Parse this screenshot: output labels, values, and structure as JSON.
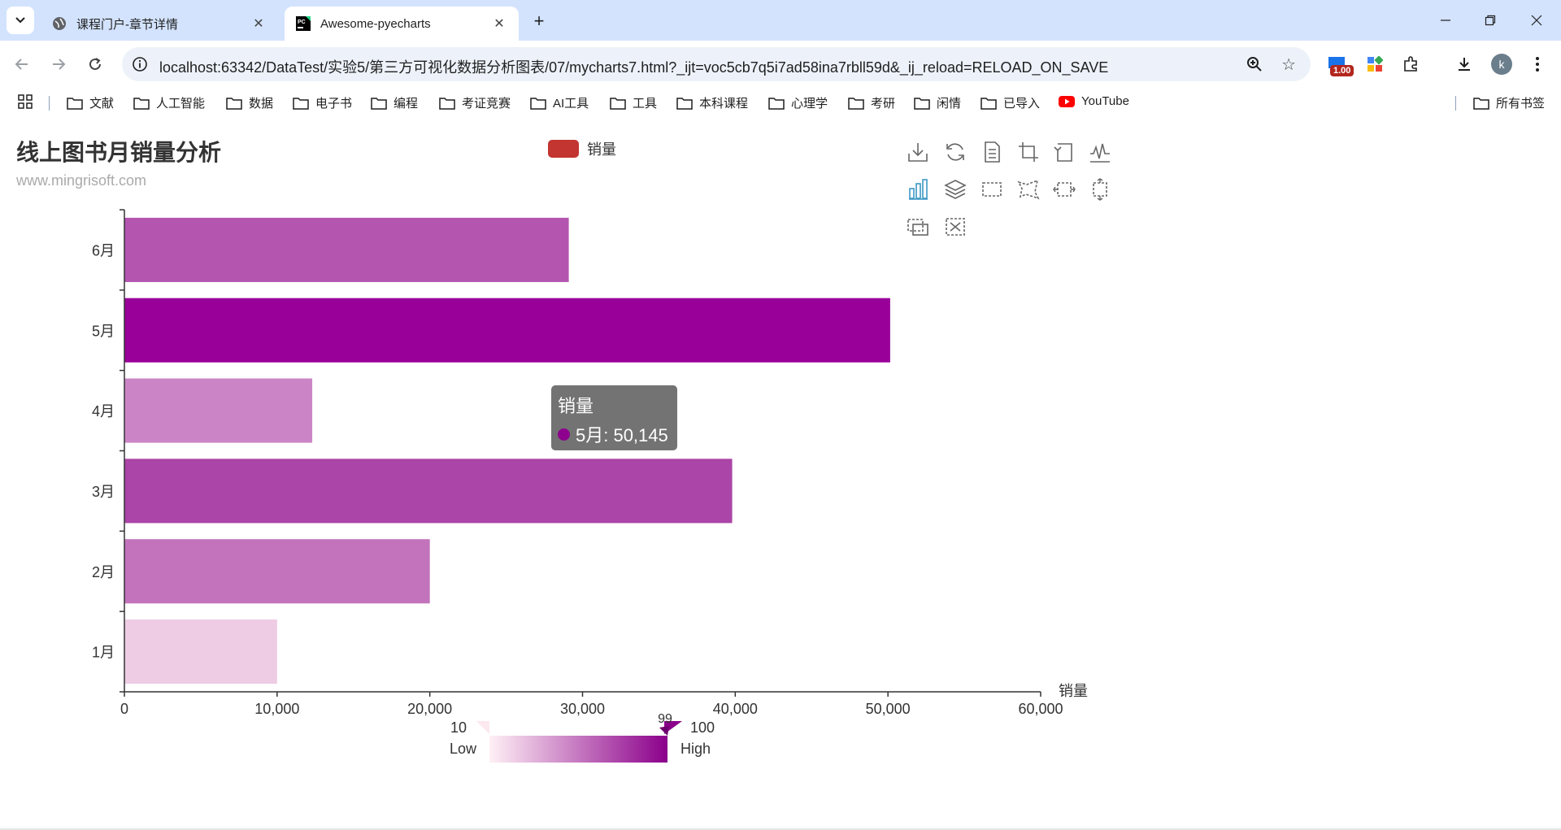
{
  "browser": {
    "tabs": [
      {
        "title": "课程门户-章节详情",
        "active": false
      },
      {
        "title": "Awesome-pyecharts",
        "active": true
      }
    ],
    "url": "localhost:63342/DataTest/实验5/第三方可视化数据分析图表/07/mycharts7.html?_ijt=voc5cb7q5i7ad58ina7rbll59d&_ij_reload=RELOAD_ON_SAVE",
    "extension_badge": "1.00",
    "profile_initial": "k",
    "bookmarks": [
      "文献",
      "人工智能",
      "数据",
      "电子书",
      "编程",
      "考证竞赛",
      "AI工具",
      "工具",
      "本科课程",
      "心理学",
      "考研",
      "闲情",
      "已导入",
      "YouTube"
    ],
    "all_bookmarks": "所有书签"
  },
  "chart": {
    "title": "线上图书月销量分析",
    "subtitle": "www.mingrisoft.com",
    "legend_label": "销量",
    "legend_color": "#c23531",
    "tooltip": {
      "series": "销量",
      "item": "5月: 50,145"
    },
    "visualmap": {
      "min_label": "10",
      "max_label": "100",
      "low_text": "Low",
      "high_text": "High",
      "handle_value": "99",
      "color_low": "#fff0f5",
      "color_high": "#8b008b"
    }
  },
  "chart_data": {
    "type": "bar",
    "orientation": "horizontal",
    "title": "线上图书月销量分析",
    "subtitle": "www.mingrisoft.com",
    "categories": [
      "1月",
      "2月",
      "3月",
      "4月",
      "5月",
      "6月"
    ],
    "series": [
      {
        "name": "销量",
        "values": [
          10000,
          20000,
          39800,
          12300,
          50145,
          29100
        ]
      }
    ],
    "xlabel": "销量",
    "xlim": [
      0,
      60000
    ],
    "xticks": [
      "0",
      "10,000",
      "20,000",
      "30,000",
      "40,000",
      "50,000",
      "60,000"
    ],
    "bar_colors": [
      "#edcce4",
      "#c273bb",
      "#ab45a7",
      "#cb85c6",
      "#990099",
      "#b455b0"
    ],
    "grid": false
  }
}
